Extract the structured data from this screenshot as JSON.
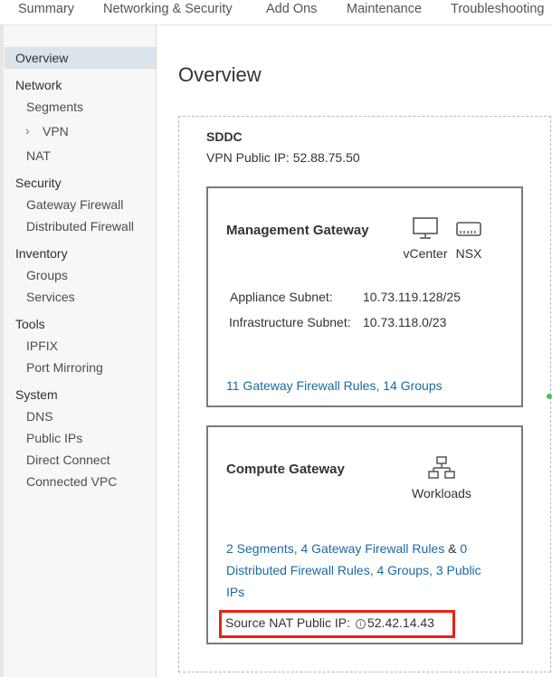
{
  "tabs": [
    "Summary",
    "Networking & Security",
    "Add Ons",
    "Maintenance",
    "Troubleshooting"
  ],
  "sidebar": {
    "overview": "Overview",
    "network": {
      "heading": "Network",
      "segments": "Segments",
      "vpn": "VPN",
      "nat": "NAT"
    },
    "security": {
      "heading": "Security",
      "gateway_firewall": "Gateway Firewall",
      "distributed_firewall": "Distributed Firewall"
    },
    "inventory": {
      "heading": "Inventory",
      "groups": "Groups",
      "services": "Services"
    },
    "tools": {
      "heading": "Tools",
      "ipfix": "IPFIX",
      "port_mirroring": "Port Mirroring"
    },
    "system": {
      "heading": "System",
      "dns": "DNS",
      "public_ips": "Public IPs",
      "direct_connect": "Direct Connect",
      "connected_vpc": "Connected VPC"
    }
  },
  "main": {
    "title": "Overview",
    "sddc": {
      "label": "SDDC",
      "vpn_public_ip": "VPN Public IP: 52.88.75.50"
    },
    "management_gateway": {
      "title": "Management Gateway",
      "icons": [
        {
          "name": "monitor-icon",
          "label": "vCenter"
        },
        {
          "name": "server-icon",
          "label": "NSX"
        }
      ],
      "appliance_subnet_label": "Appliance Subnet:",
      "appliance_subnet_value": "10.73.119.128/25",
      "infrastructure_subnet_label": "Infrastructure Subnet:",
      "infrastructure_subnet_value": "10.73.118.0/23",
      "rules_link": "11 Gateway Firewall Rules, 14 Groups"
    },
    "compute_gateway": {
      "title": "Compute Gateway",
      "icon": {
        "name": "network-topology-icon",
        "label": "Workloads"
      },
      "summary": {
        "segments_link": "2 Segments, 4 Gateway Firewall Rules",
        "amp": "&",
        "zero_link": "0",
        "distributed_link": "Distributed Firewall Rules, 4 Groups, 3 Public",
        "ips_link": "IPs"
      },
      "source_nat_label": "Source NAT Public IP:",
      "info_glyph": "i",
      "source_nat_value": "52.42.14.43"
    }
  },
  "colors": {
    "link": "#1a6aa4",
    "highlight": "#e8220f",
    "selected_bg": "#dbe4ea"
  }
}
